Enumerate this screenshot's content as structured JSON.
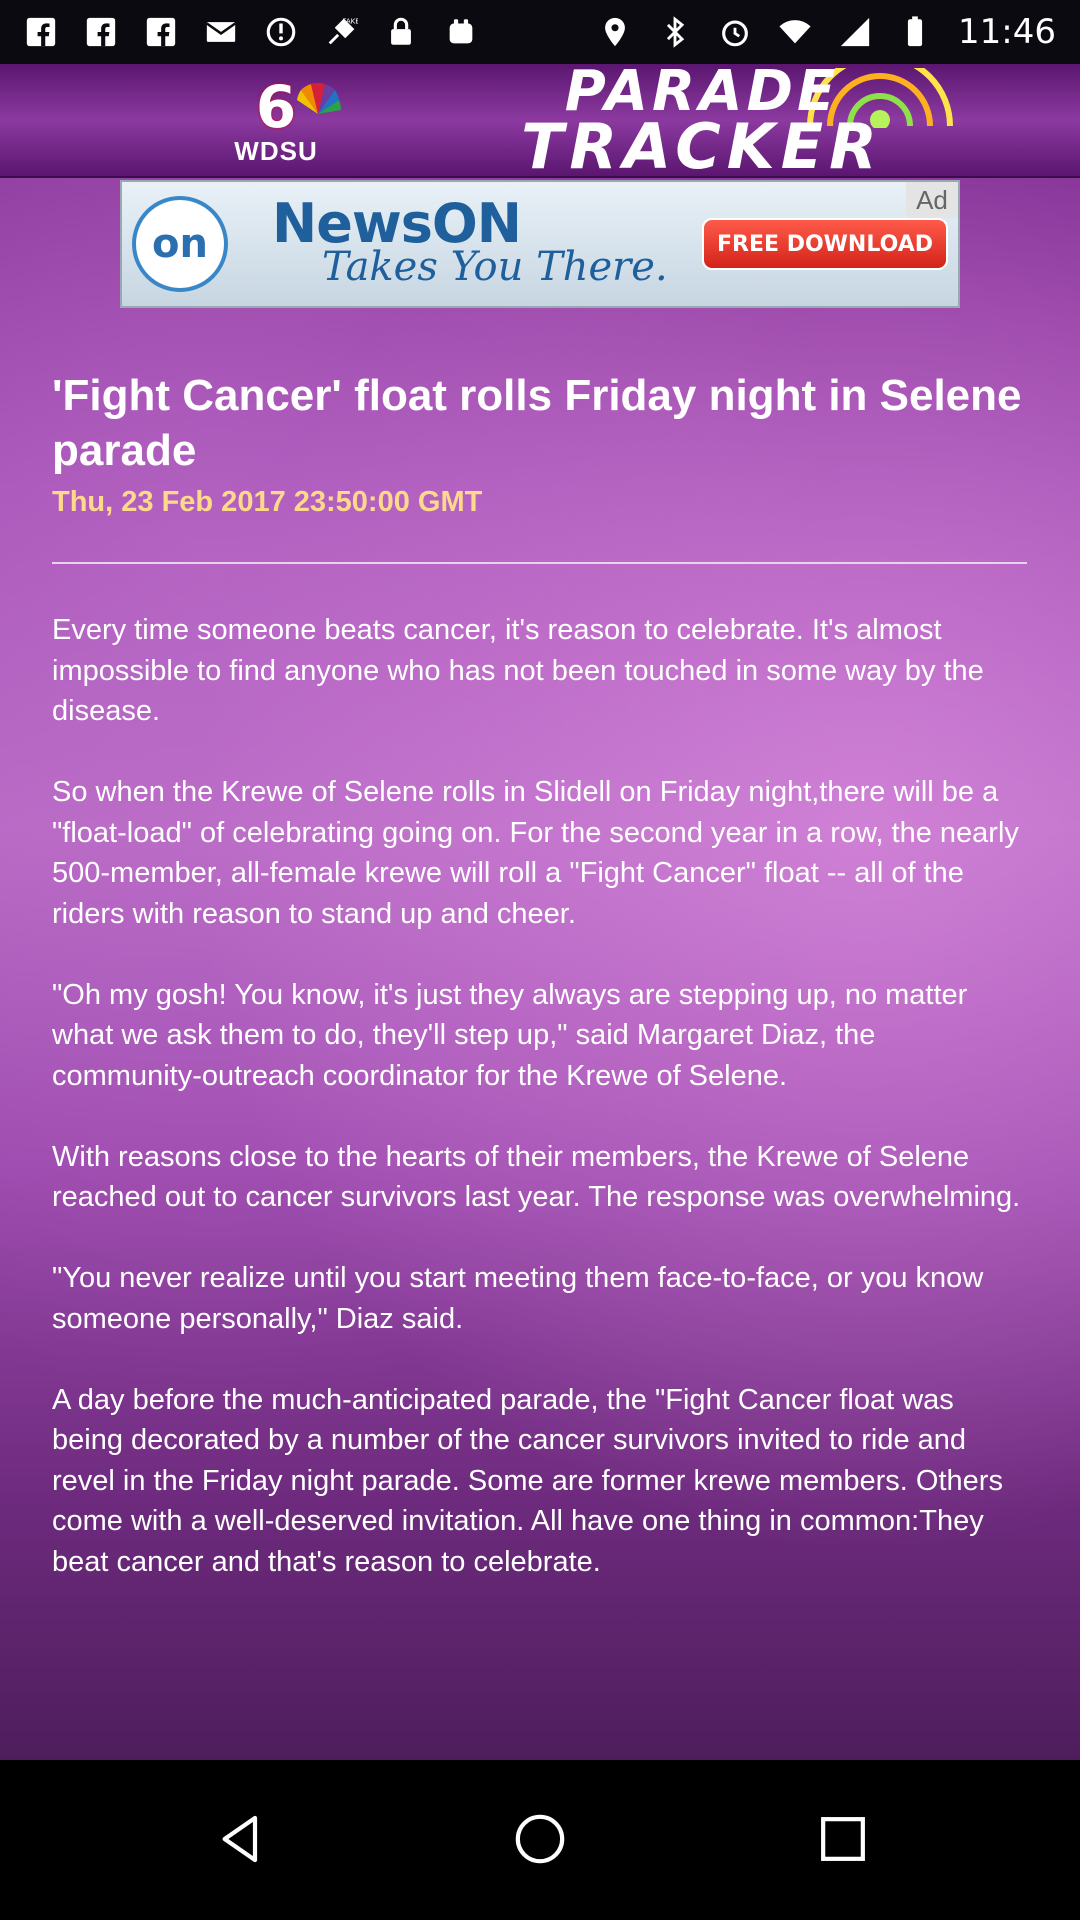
{
  "status_bar": {
    "time": "11:46",
    "left_icons": [
      "facebook-icon",
      "facebook-icon",
      "facebook-icon",
      "mail-icon",
      "sync-icon",
      "fake-gps-icon",
      "lock-icon",
      "notification-icon"
    ],
    "right_icons": [
      "location-icon",
      "bluetooth-icon",
      "alarm-icon",
      "wifi-icon",
      "signal-icon",
      "battery-icon"
    ]
  },
  "banner": {
    "station_number": "6",
    "station_call": "WDSU",
    "title_line1": "PARADE",
    "title_line2": "TRACKER"
  },
  "ad": {
    "logo_text": "on",
    "brand": "NewsON",
    "tagline": "Takes You There.",
    "cta": "FREE DOWNLOAD",
    "badge": "Ad"
  },
  "article": {
    "title": "'Fight Cancer' float rolls Friday night in Selene parade",
    "date": "Thu, 23 Feb 2017 23:50:00 GMT",
    "paragraphs": [
      "Every time someone beats cancer, it's reason to celebrate. It's almost impossible to find anyone who has not been touched in some way by the disease.",
      "So when the Krewe of Selene rolls in Slidell on Friday night,there will be a \"float-load\" of celebrating going on. For the second year in a row, the nearly 500-member, all-female krewe will roll a \"Fight Cancer\" float -- all of the riders with reason to stand up and cheer.",
      "\"Oh my gosh! You know, it's just they always are stepping up, no matter what we ask them to do, they'll step up,\" said Margaret Diaz, the community-outreach coordinator for the Krewe of Selene.",
      "With reasons close to the hearts of their members, the Krewe of Selene reached out to cancer survivors last year. The response was overwhelming.",
      "\"You never realize until you start meeting them face-to-face, or you know someone personally,\" Diaz said.",
      "A day before the much-anticipated parade, the \"Fight Cancer float was being decorated by a number of the cancer survivors invited to ride and revel in the Friday night parade. Some are former krewe members. Others come with a well-deserved invitation. All have one thing in common:They beat cancer and that's reason to celebrate."
    ]
  },
  "nav_bar": {
    "back": "back-icon",
    "home": "home-icon",
    "recents": "recents-icon"
  }
}
